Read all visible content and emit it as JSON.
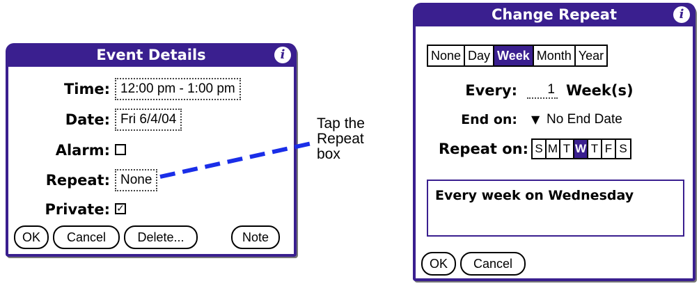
{
  "event_details": {
    "title": "Event Details",
    "info_icon": "i",
    "time_label": "Time:",
    "time_value": "12:00 pm - 1:00 pm",
    "date_label": "Date:",
    "date_value": "Fri 6/4/04",
    "alarm_label": "Alarm:",
    "alarm_checked": false,
    "repeat_label": "Repeat:",
    "repeat_value": "None",
    "private_label": "Private:",
    "private_checked": true,
    "private_check_glyph": "✓",
    "buttons": {
      "ok": "OK",
      "cancel": "Cancel",
      "delete": "Delete...",
      "note": "Note"
    }
  },
  "callout": {
    "line1": "Tap the",
    "line2": "Repeat",
    "line3": "box",
    "color": "#1a2ee8"
  },
  "change_repeat": {
    "title": "Change Repeat",
    "info_icon": "i",
    "frequency_options": [
      "None",
      "Day",
      "Week",
      "Month",
      "Year"
    ],
    "frequency_selected": "Week",
    "every_label": "Every:",
    "every_value": "1",
    "every_unit": "Week(s)",
    "end_on_label": "End on:",
    "end_on_value": "No End Date",
    "repeat_on_label": "Repeat on:",
    "days": [
      "S",
      "M",
      "T",
      "W",
      "T",
      "F",
      "S"
    ],
    "selected_day": "W",
    "description": "Every week on Wednesday",
    "buttons": {
      "ok": "OK",
      "cancel": "Cancel"
    }
  },
  "colors": {
    "accent": "#3a1f8f"
  }
}
